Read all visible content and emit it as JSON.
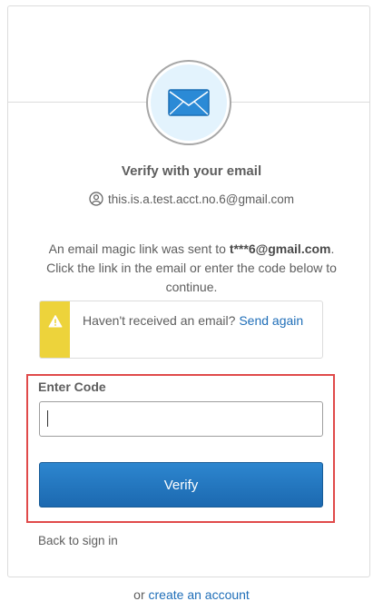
{
  "header": {
    "title": "Verify with your email",
    "identity": "this.is.a.test.acct.no.6@gmail.com",
    "icon": "envelope-icon",
    "accent_color": "#1f6eb8"
  },
  "message": {
    "text_before": "An email magic link was sent to ",
    "masked_email": "t***6@gmail.com",
    "text_after": ". Click the link in the email or enter the code below to continue."
  },
  "callout": {
    "icon": "warning-icon",
    "text": "Haven't received an email? ",
    "link": "Send again",
    "bar_color": "#edd33b"
  },
  "form": {
    "code_label": "Enter Code",
    "code_value": "",
    "verify_label": "Verify"
  },
  "back_label": "Back to sign in",
  "footer": {
    "prefix": "or ",
    "link": "create an account"
  }
}
